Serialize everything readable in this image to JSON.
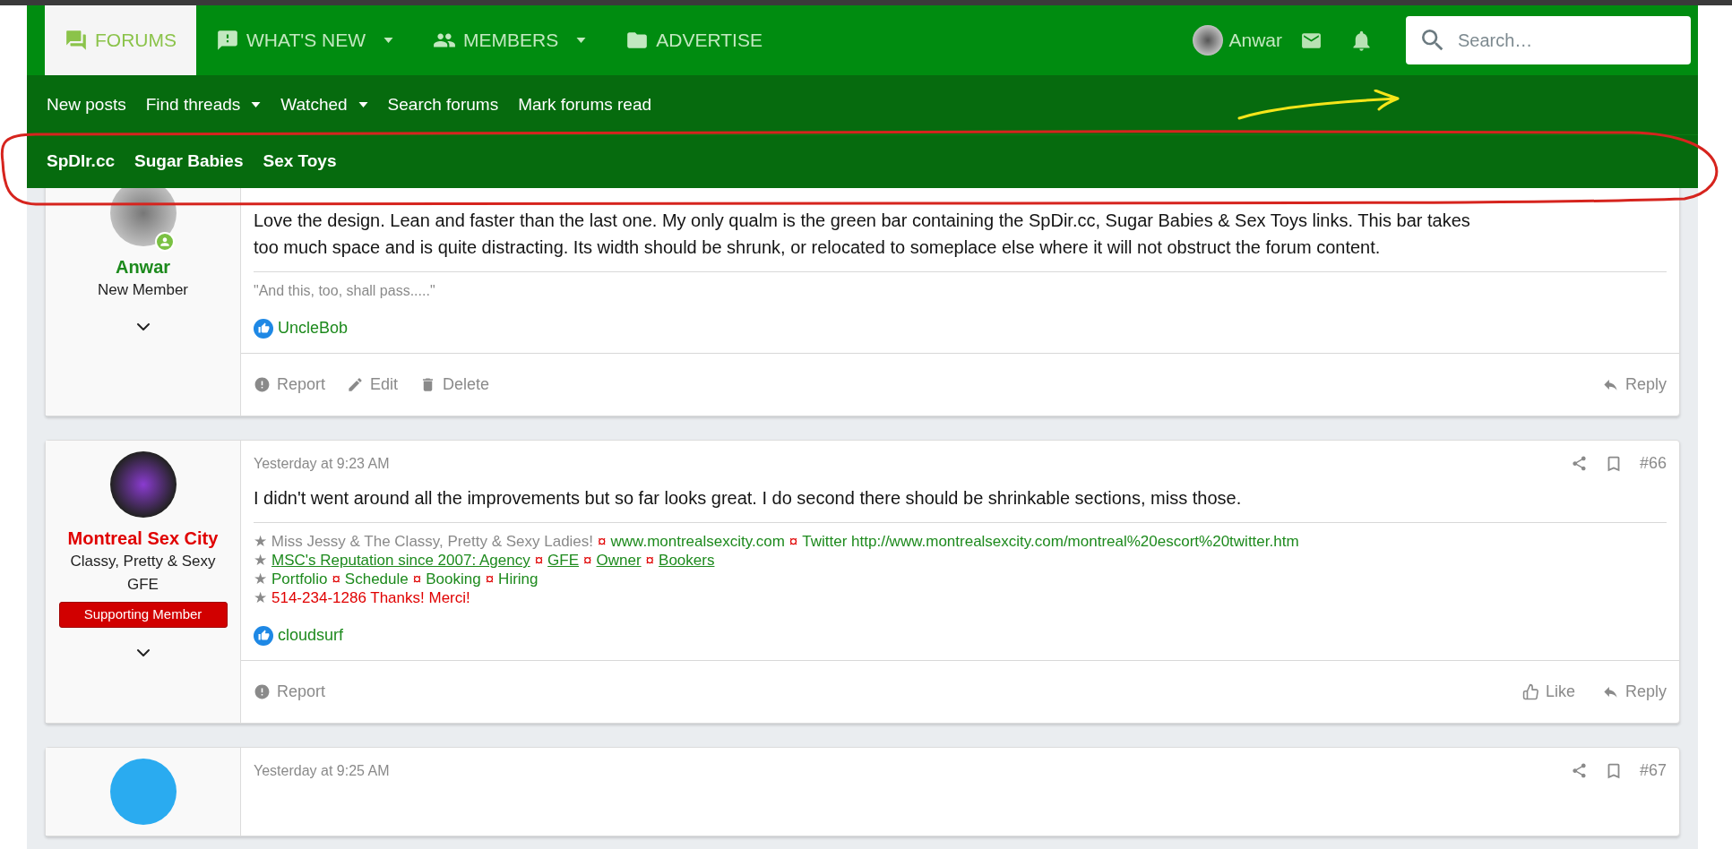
{
  "nav": {
    "tabs": [
      {
        "label": "FORUMS",
        "dropdown": false,
        "selected": true
      },
      {
        "label": "WHAT'S NEW",
        "dropdown": true,
        "selected": false
      },
      {
        "label": "MEMBERS",
        "dropdown": true,
        "selected": false
      },
      {
        "label": "ADVERTISE",
        "dropdown": false,
        "selected": false
      }
    ],
    "user": {
      "name": "Anwar"
    },
    "search": {
      "placeholder": "Search…"
    }
  },
  "subnav": [
    {
      "label": "New posts",
      "dropdown": false
    },
    {
      "label": "Find threads",
      "dropdown": true
    },
    {
      "label": "Watched",
      "dropdown": true
    },
    {
      "label": "Search forums",
      "dropdown": false
    },
    {
      "label": "Mark forums read",
      "dropdown": false
    }
  ],
  "promo_bar": [
    "SpDIr.cc",
    "Sugar Babies",
    "Sex Toys"
  ],
  "posts": [
    {
      "author": {
        "name": "Anwar",
        "color": "#1d8a1d",
        "title": "New Member",
        "online": true
      },
      "body": "Love the design. Lean and faster than the last one. My only qualm is the green bar containing the SpDir.cc, Sugar Babies & Sex Toys links. This bar takes too much space and is quite distracting. Its width should be shrunk, or relocated to someplace else where it will not obstruct the forum content.",
      "signature": [
        [
          {
            "kind": "quote",
            "text": "\"And this, too, shall pass.....\""
          }
        ]
      ],
      "likes": "UncleBob",
      "actions": [
        {
          "kind": "report",
          "label": "Report"
        },
        {
          "kind": "edit",
          "label": "Edit"
        },
        {
          "kind": "delete",
          "label": "Delete"
        }
      ],
      "right_actions": [
        {
          "kind": "reply",
          "label": "Reply"
        }
      ]
    },
    {
      "author": {
        "name": "Montreal Sex City",
        "color": "#e00000",
        "title": "Classy, Pretty & Sexy GFE",
        "online": false,
        "banner": "Supporting Member"
      },
      "date": "Yesterday at 9:23 AM",
      "number": "#66",
      "body": "I didn't went around all the improvements but so far looks great. I do second there should be shrinkable sections, miss those.",
      "signature": [
        [
          {
            "kind": "plain",
            "text": "★ Miss Jessy & The Classy, Pretty & Sexy Ladies!"
          },
          {
            "kind": "sep",
            "text": "¤"
          },
          {
            "kind": "link",
            "text": "www.montrealsexcity.com"
          },
          {
            "kind": "sep",
            "text": "¤"
          },
          {
            "kind": "link",
            "text": "Twitter http://www.montrealsexcity.com/montreal%20escort%20twitter.htm"
          }
        ],
        [
          {
            "kind": "plain",
            "text": "★"
          },
          {
            "kind": "underline",
            "text": "MSC's Reputation since 2007: Agency"
          },
          {
            "kind": "sep",
            "text": "¤"
          },
          {
            "kind": "underline",
            "text": "GFE"
          },
          {
            "kind": "sep",
            "text": "¤"
          },
          {
            "kind": "underline",
            "text": "Owner"
          },
          {
            "kind": "sep",
            "text": "¤"
          },
          {
            "kind": "underline",
            "text": "Bookers"
          }
        ],
        [
          {
            "kind": "plain",
            "text": "★"
          },
          {
            "kind": "link",
            "text": "Portfolio"
          },
          {
            "kind": "sep",
            "text": "¤"
          },
          {
            "kind": "link",
            "text": "Schedule"
          },
          {
            "kind": "sep",
            "text": "¤"
          },
          {
            "kind": "link",
            "text": "Booking"
          },
          {
            "kind": "sep",
            "text": "¤"
          },
          {
            "kind": "link",
            "text": "Hiring"
          }
        ],
        [
          {
            "kind": "plain",
            "text": "★"
          },
          {
            "kind": "alert",
            "text": "514-234-1286 Thanks! Merci!"
          }
        ]
      ],
      "likes": "cloudsurf",
      "actions": [
        {
          "kind": "report",
          "label": "Report"
        }
      ],
      "right_actions": [
        {
          "kind": "like",
          "label": "Like"
        },
        {
          "kind": "reply",
          "label": "Reply"
        }
      ]
    },
    {
      "author": {
        "online": false
      },
      "date": "Yesterday at 9:25 AM",
      "number": "#67"
    }
  ]
}
